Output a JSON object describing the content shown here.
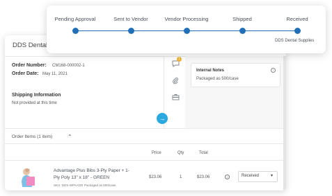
{
  "order_card": {
    "title": "DDS Dental",
    "order_number_label": "Order Number:",
    "order_number": "CM168-000002-1",
    "order_date_label": "Order Date:",
    "order_date": "May 11, 2021",
    "shipping_label": "Shipping Information",
    "shipping_value": "Not provided at this time",
    "notification_badge": "1",
    "notes_title": "Internal Notes",
    "notes_text": "Packaged as 500/case"
  },
  "items": {
    "header": "Order Items (1 item)",
    "columns": [
      "Price",
      "Qty",
      "Total"
    ],
    "rows": [
      {
        "name_line1": "Advantage Plus Bibs 3-Ply Paper + 1-",
        "name_line2": "Ply Poly 13\" x 18\" - GREEN",
        "sku": "SKU: DDS-WPAAGR",
        "packaged": "Packaged as 500/case",
        "price": "$23.06",
        "qty": "1",
        "total": "$23.06",
        "status": "Received"
      }
    ]
  },
  "tracker": {
    "steps": [
      {
        "label": "Pending Approval"
      },
      {
        "label": "Sent to Vendor"
      },
      {
        "label": "Vendor Processing"
      },
      {
        "label": "Shipped"
      },
      {
        "label": "Received"
      }
    ],
    "received_by": "DDS Dental Supplies"
  },
  "colors": {
    "accent": "#1f6fb9",
    "action": "#2aa9e0",
    "badge": "#f2b233"
  }
}
